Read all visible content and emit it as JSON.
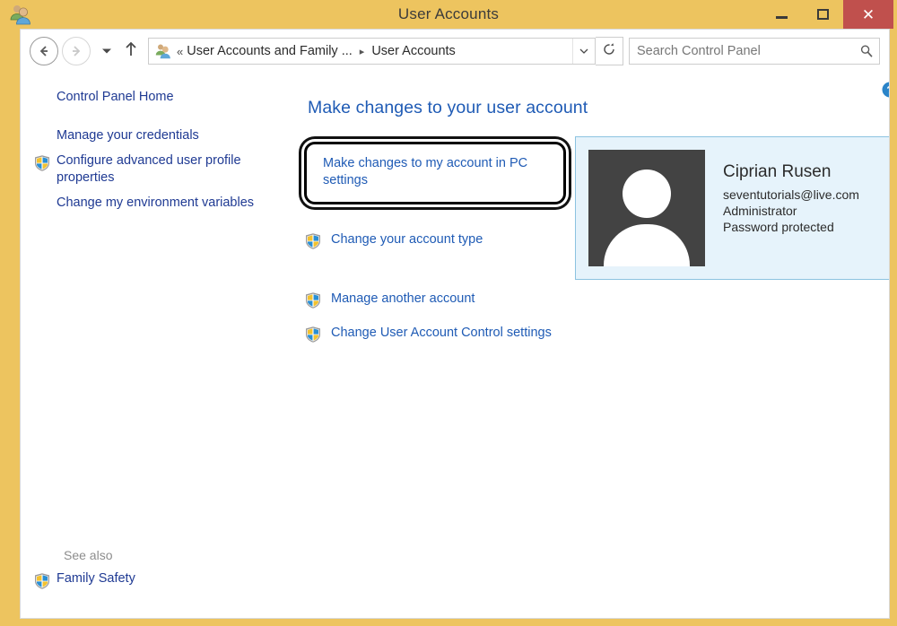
{
  "window": {
    "title": "User Accounts",
    "title_icon": "user-accounts-icon",
    "minimize_label": "–",
    "maximize_label": "□",
    "close_label": "✕",
    "frame_color": "#edc45f",
    "close_button_color": "#c0504d"
  },
  "navbar": {
    "back_label": "Back",
    "forward_label": "Forward",
    "recent_label": "Recent locations",
    "up_label": "Up one level",
    "breadcrumb": {
      "icon": "user-accounts-icon",
      "overflow": "«",
      "segments": [
        "User Accounts and Family ...",
        "User Accounts"
      ],
      "separator": "▸",
      "caret": "⌄"
    },
    "refresh_label": "Refresh",
    "search": {
      "placeholder": "Search Control Panel",
      "value": "",
      "icon": "search-icon"
    }
  },
  "sidebar": {
    "home_label": "Control Panel Home",
    "items": [
      {
        "label": "Manage your credentials",
        "shield": false
      },
      {
        "label": "Configure advanced user profile properties",
        "shield": true
      },
      {
        "label": "Change my environment variables",
        "shield": false
      }
    ],
    "see_also_label": "See also",
    "see_also_items": [
      {
        "label": "Family Safety",
        "shield": true
      }
    ]
  },
  "content": {
    "help_label": "?",
    "title": "Make changes to your user account",
    "highlighted_link": "Make changes to my account in PC settings",
    "links": [
      {
        "label": "Change your account type",
        "shield": true
      },
      {
        "label": "Manage another account",
        "shield": true
      },
      {
        "label": "Change User Account Control settings",
        "shield": true
      }
    ],
    "user": {
      "avatar": "default-user-avatar",
      "name": "Ciprian Rusen",
      "email": "seventutorials@live.com",
      "account_type": "Administrator",
      "password_status": "Password protected",
      "panel_bg": "#e6f3fb",
      "panel_border": "#8cc3e0"
    }
  }
}
